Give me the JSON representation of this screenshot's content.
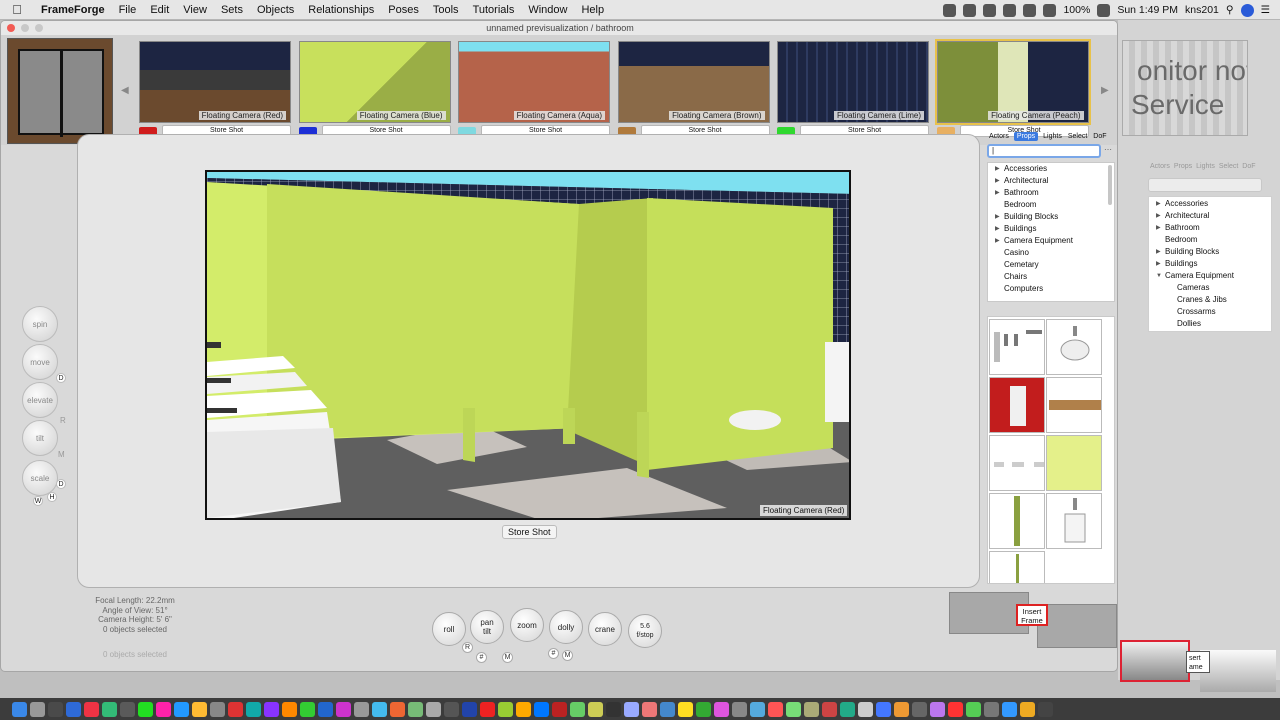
{
  "menubar": {
    "app_name": "FrameForge",
    "items": [
      "File",
      "Edit",
      "View",
      "Sets",
      "Objects",
      "Relationships",
      "Poses",
      "Tools",
      "Tutorials",
      "Window",
      "Help"
    ],
    "battery": "100%",
    "clock": "Sun 1:49 PM",
    "user": "kns201"
  },
  "window": {
    "title": "unnamed previsualization / bathroom"
  },
  "cameras": [
    {
      "label": "Floating Camera (Red)",
      "button": "Store Shot",
      "color": "#d01c1c",
      "selected": false
    },
    {
      "label": "Floating Camera (Blue)",
      "button": "Store Shot",
      "color": "#1d2fd6",
      "selected": false
    },
    {
      "label": "Floating Camera (Aqua)",
      "button": "Store Shot",
      "color": "#7fd9e0",
      "selected": false
    },
    {
      "label": "Floating Camera (Brown)",
      "button": "Store Shot",
      "color": "#b07a3c",
      "selected": false
    },
    {
      "label": "Floating Camera (Lime)",
      "button": "Store Shot",
      "color": "#2fd82f",
      "selected": false
    },
    {
      "label": "Floating Camera (Peach)",
      "button": "Store Shot",
      "color": "#e8b062",
      "selected": true
    }
  ],
  "viewport": {
    "label": "Floating Camera (Red)",
    "store_shot": "Store Shot"
  },
  "rail": {
    "spin": "spin",
    "move": "move",
    "elevate": "elevate",
    "tilt": "tilt",
    "scale": "scale",
    "letters": [
      "D",
      "R",
      "M",
      "D",
      "W",
      "H"
    ]
  },
  "panel": {
    "tabs": [
      "Actors",
      "Props",
      "Lights",
      "Select",
      "DoF"
    ],
    "active_tab": "Props",
    "search_value": "",
    "categories": [
      {
        "label": "Accessories",
        "expandable": true
      },
      {
        "label": "Architectural",
        "expandable": true
      },
      {
        "label": "Bathroom",
        "expandable": true
      },
      {
        "label": "Bedroom",
        "expandable": false
      },
      {
        "label": "Building Blocks",
        "expandable": true
      },
      {
        "label": "Buildings",
        "expandable": true
      },
      {
        "label": "Camera Equipment",
        "expandable": true
      },
      {
        "label": "Casino",
        "expandable": false
      },
      {
        "label": "Cemetary",
        "expandable": false
      },
      {
        "label": "Chairs",
        "expandable": false
      },
      {
        "label": "Computers",
        "expandable": false
      }
    ]
  },
  "camera_info": {
    "focal_length": "Focal Length: 22.2mm",
    "angle_of_view": "Angle of View: 51°",
    "camera_height": "Camera Height: 5' 6\"",
    "selected": "0 objects selected",
    "bg_selected": "0 objects selected"
  },
  "controls": {
    "roll": "roll",
    "pan_tilt": "pan\ntilt",
    "zoom": "zoom",
    "dolly": "dolly",
    "crane": "crane",
    "fstop_value": "5.6",
    "fstop_label": "f/stop"
  },
  "frames": {
    "insert_frame": "Insert\nFrame"
  },
  "background": {
    "monitor_line1": "onitor not",
    "monitor_line2": "Service",
    "tabs": [
      "Actors",
      "Props",
      "Lights",
      "Select",
      "DoF"
    ],
    "categories": [
      {
        "label": "Accessories",
        "expandable": true,
        "indent": 0
      },
      {
        "label": "Architectural",
        "expandable": true,
        "indent": 0
      },
      {
        "label": "Bathroom",
        "expandable": true,
        "indent": 0
      },
      {
        "label": "Bedroom",
        "expandable": false,
        "indent": 0
      },
      {
        "label": "Building Blocks",
        "expandable": true,
        "indent": 0
      },
      {
        "label": "Buildings",
        "expandable": true,
        "indent": 0
      },
      {
        "label": "Camera Equipment",
        "expandable": true,
        "indent": 0,
        "open": true
      },
      {
        "label": "Cameras",
        "expandable": false,
        "indent": 1
      },
      {
        "label": "Cranes & Jibs",
        "expandable": false,
        "indent": 1
      },
      {
        "label": "Crossarms",
        "expandable": false,
        "indent": 1
      },
      {
        "label": "Dollies",
        "expandable": false,
        "indent": 1
      }
    ],
    "insert_frame": "sert\name"
  },
  "colors": {
    "stall": "#c8e05c",
    "tile": "#1d2542",
    "sky": "#7ee0f0",
    "floor": "#6b6b6b"
  }
}
